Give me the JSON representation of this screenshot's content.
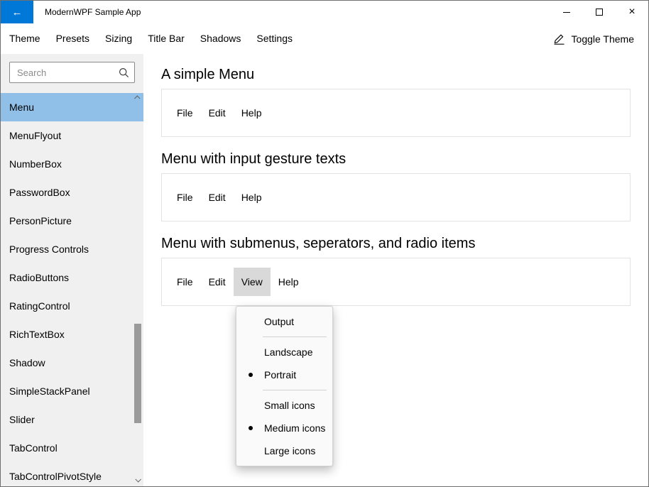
{
  "window": {
    "title": "ModernWPF Sample App",
    "icons": {
      "back": "←",
      "close": "×"
    }
  },
  "menubar": {
    "items": [
      "Theme",
      "Presets",
      "Sizing",
      "Title Bar",
      "Shadows",
      "Settings"
    ],
    "toggle_theme_label": "Toggle Theme"
  },
  "sidebar": {
    "search_placeholder": "Search",
    "selected": "Menu",
    "items": [
      "Menu",
      "MenuFlyout",
      "NumberBox",
      "PasswordBox",
      "PersonPicture",
      "Progress Controls",
      "RadioButtons",
      "RatingControl",
      "RichTextBox",
      "Shadow",
      "SimpleStackPanel",
      "Slider",
      "TabControl",
      "TabControlPivotStyle"
    ]
  },
  "main": {
    "sections": [
      {
        "title": "A simple Menu",
        "menu": [
          "File",
          "Edit",
          "Help"
        ],
        "active": ""
      },
      {
        "title": "Menu with input gesture texts",
        "menu": [
          "File",
          "Edit",
          "Help"
        ],
        "active": ""
      },
      {
        "title": "Menu with submenus, seperators, and radio items",
        "menu": [
          "File",
          "Edit",
          "View",
          "Help"
        ],
        "active": "View"
      }
    ],
    "view_dropdown": [
      {
        "type": "item",
        "label": "Output",
        "checked": false
      },
      {
        "type": "separator"
      },
      {
        "type": "radio",
        "label": "Landscape",
        "checked": false
      },
      {
        "type": "radio",
        "label": "Portrait",
        "checked": true
      },
      {
        "type": "separator"
      },
      {
        "type": "radio",
        "label": "Small icons",
        "checked": false
      },
      {
        "type": "radio",
        "label": "Medium icons",
        "checked": true
      },
      {
        "type": "radio",
        "label": "Large icons",
        "checked": false
      }
    ]
  },
  "colors": {
    "accent": "#0078d7",
    "sidebar_selection": "#90c0e8",
    "menu_active": "#d9d9d9"
  }
}
